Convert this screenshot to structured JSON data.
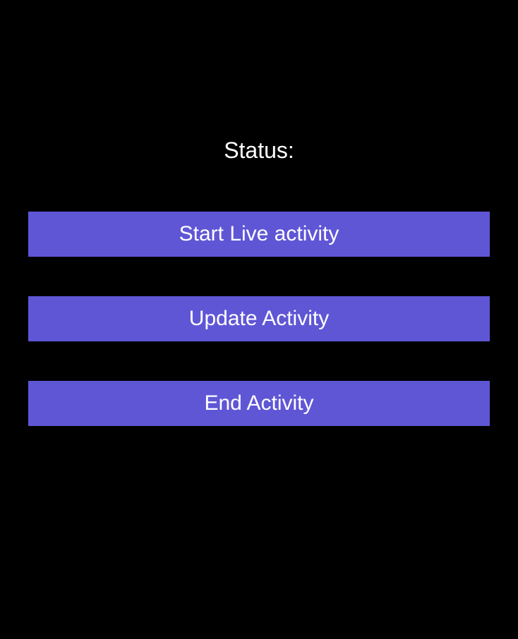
{
  "status": {
    "label": "Status:"
  },
  "buttons": {
    "start": "Start Live activity",
    "update": "Update Activity",
    "end": "End Activity"
  },
  "colors": {
    "background": "#000000",
    "button_bg": "#5f56d6",
    "text": "#ffffff"
  }
}
